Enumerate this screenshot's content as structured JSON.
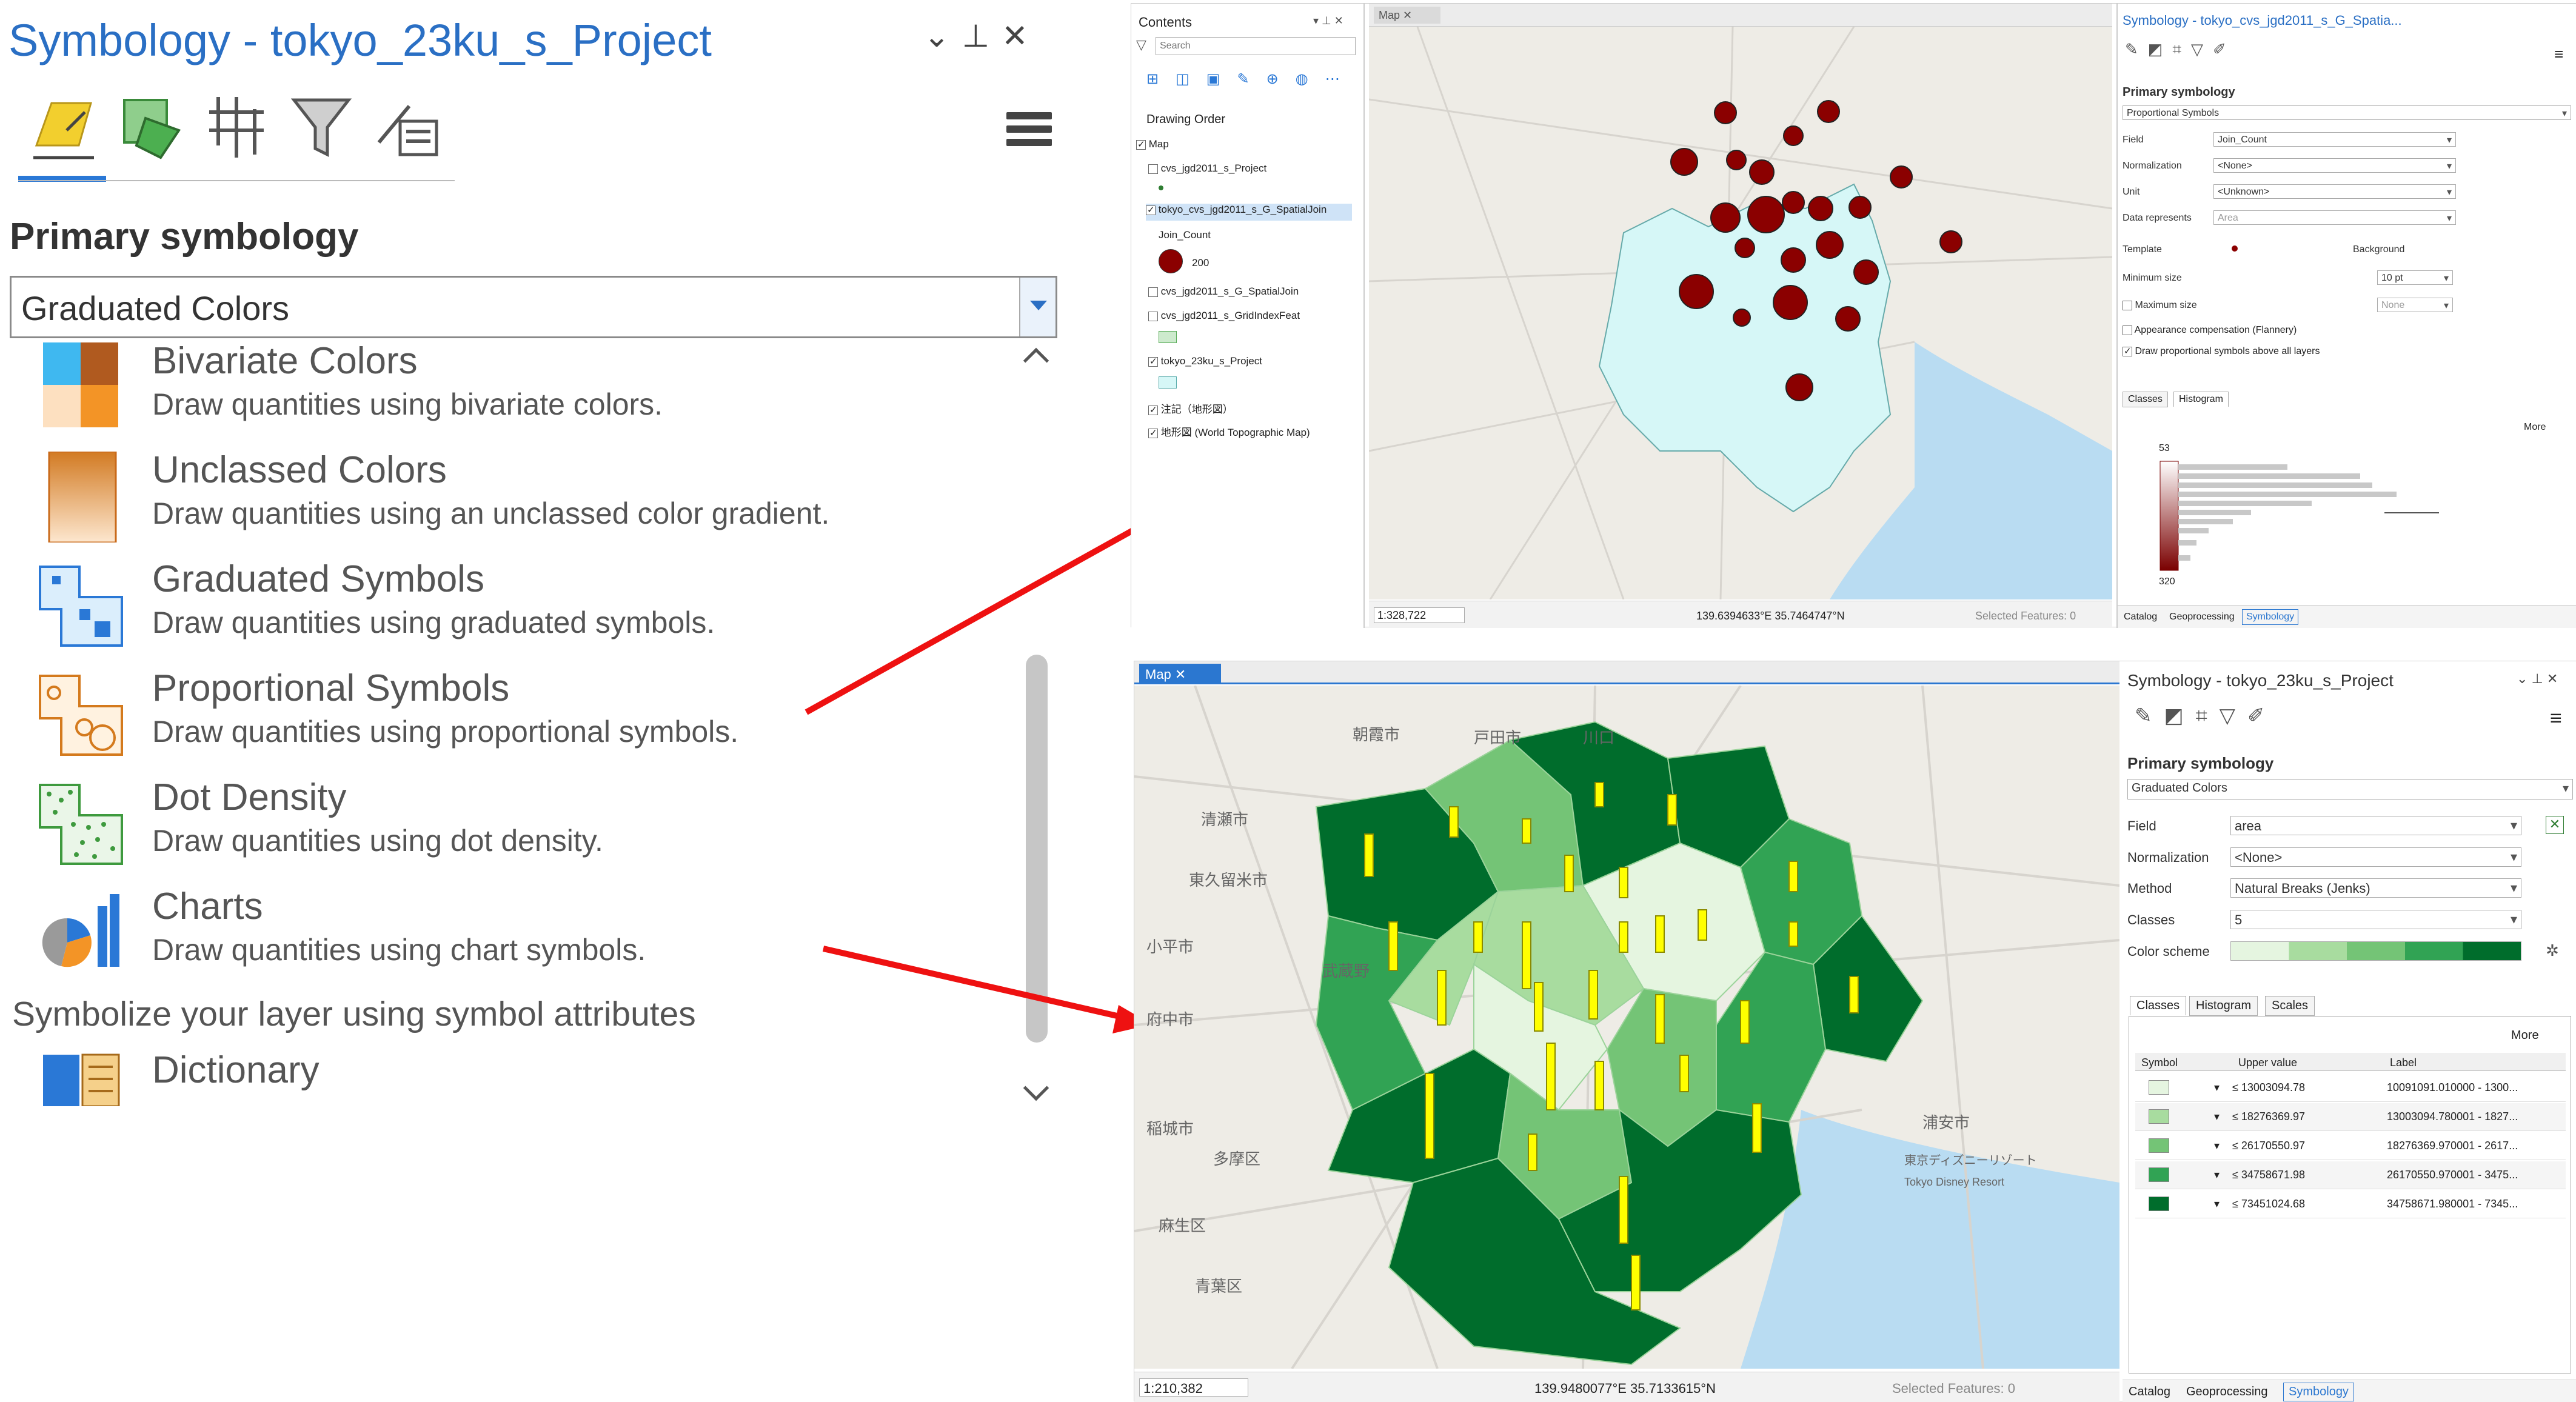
{
  "main_panel": {
    "title": "Symbology - tokyo_23ku_s_Project",
    "primary_symbology_label": "Primary symbology",
    "dropdown_value": "Graduated Colors",
    "items": [
      {
        "name": "Bivariate Colors",
        "desc": "Draw quantities using bivariate colors.",
        "icon": "bivariate-colors-icon"
      },
      {
        "name": "Unclassed Colors",
        "desc": "Draw quantities using an unclassed color gradient.",
        "icon": "unclassed-colors-icon"
      },
      {
        "name": "Graduated Symbols",
        "desc": "Draw quantities using graduated symbols.",
        "icon": "graduated-symbols-icon"
      },
      {
        "name": "Proportional Symbols",
        "desc": "Draw quantities using proportional symbols.",
        "icon": "proportional-symbols-icon"
      },
      {
        "name": "Dot Density",
        "desc": "Draw quantities using dot density.",
        "icon": "dot-density-icon"
      },
      {
        "name": "Charts",
        "desc": "Draw quantities using chart symbols.",
        "icon": "charts-icon"
      }
    ],
    "attr_section": "Symbolize your layer using symbol attributes",
    "dictionary_item": "Dictionary"
  },
  "top": {
    "contents": {
      "title": "Contents",
      "search_placeholder": "Search",
      "drawing_order": "Drawing Order",
      "layers": [
        {
          "label": "Map"
        },
        {
          "label": "cvs_jgd2011_s_Project"
        },
        {
          "label": "tokyo_cvs_jgd2011_s_G_SpatialJoin"
        },
        {
          "label": "Join_Count"
        },
        {
          "label": "200"
        },
        {
          "label": "cvs_jgd2011_s_G_SpatialJoin"
        },
        {
          "label": "cvs_jgd2011_s_GridIndexFeat"
        },
        {
          "label": "tokyo_23ku_s_Project"
        },
        {
          "label": "注記（地形図）"
        },
        {
          "label": "地形図 (World Topographic Map)"
        }
      ]
    },
    "map": {
      "tab": "Map",
      "scale": "1:328,722",
      "coords": "139.6394633°E 35.7464747°N",
      "selected": "Selected Features: 0"
    },
    "symbology": {
      "title": "Symbology - tokyo_cvs_jgd2011_s_G_Spatia...",
      "primary": "Primary symbology",
      "type": "Proportional Symbols",
      "field_label": "Field",
      "field": "Join_Count",
      "norm_label": "Normalization",
      "norm": "<None>",
      "unit_label": "Unit",
      "unit": "<Unknown>",
      "data_rep_label": "Data represents",
      "data_rep": "Area",
      "template_label": "Template",
      "background_label": "Background",
      "min_label": "Minimum size",
      "min": "10 pt",
      "max_label": "Maximum size",
      "max": "None",
      "appearance": "Appearance compensation (Flannery)",
      "draw_above": "Draw proportional symbols above all layers",
      "tab_classes": "Classes",
      "tab_histogram": "Histogram",
      "more": "More",
      "hist_top": "53",
      "hist_bottom": "320",
      "footer_tabs": [
        "Catalog",
        "Geoprocessing",
        "Symbology"
      ]
    }
  },
  "bottom": {
    "map": {
      "tab": "Map",
      "scale": "1:210,382",
      "coords": "139.9480077°E 35.7133615°N",
      "selected": "Selected Features: 0"
    },
    "symbology": {
      "title": "Symbology - tokyo_23ku_s_Project",
      "primary": "Primary symbology",
      "type": "Graduated Colors",
      "field_label": "Field",
      "field": "area",
      "norm_label": "Normalization",
      "norm": "<None>",
      "method_label": "Method",
      "method": "Natural Breaks (Jenks)",
      "classes_label": "Classes",
      "classes": "5",
      "scheme_label": "Color scheme",
      "tabs": [
        "Classes",
        "Histogram",
        "Scales"
      ],
      "more": "More",
      "col_symbol": "Symbol",
      "col_upper": "Upper value",
      "col_label": "Label",
      "rows": [
        {
          "color": "#e5f5e0",
          "upper": "13003094.78",
          "label": "10091091.010000 - 1300..."
        },
        {
          "color": "#a8dc9f",
          "upper": "18276369.97",
          "label": "13003094.780001 - 1827..."
        },
        {
          "color": "#74c476",
          "upper": "26170550.97",
          "label": "18276369.970001 - 2617..."
        },
        {
          "color": "#31a354",
          "upper": "34758671.98",
          "label": "26170550.970001 - 3475..."
        },
        {
          "color": "#006d2c",
          "upper": "73451024.68",
          "label": "34758671.980001 - 7345..."
        }
      ],
      "footer_tabs": [
        "Catalog",
        "Geoprocessing",
        "Symbology"
      ]
    },
    "map_labels": [
      "朝霞市",
      "戸田市",
      "川口",
      "清瀬市",
      "東久留米市",
      "小平市",
      "武蔵野",
      "府中市",
      "稲城市",
      "多摩区",
      "麻生区",
      "青葉区",
      "浦安市",
      "東京ディズニーリゾート",
      "Tokyo Disney Resort"
    ]
  },
  "colors": {
    "accent": "#2b77d0",
    "arrow": "#ee1111",
    "bubble": "#8b0000",
    "polygon_light": "#d6f7f7"
  }
}
